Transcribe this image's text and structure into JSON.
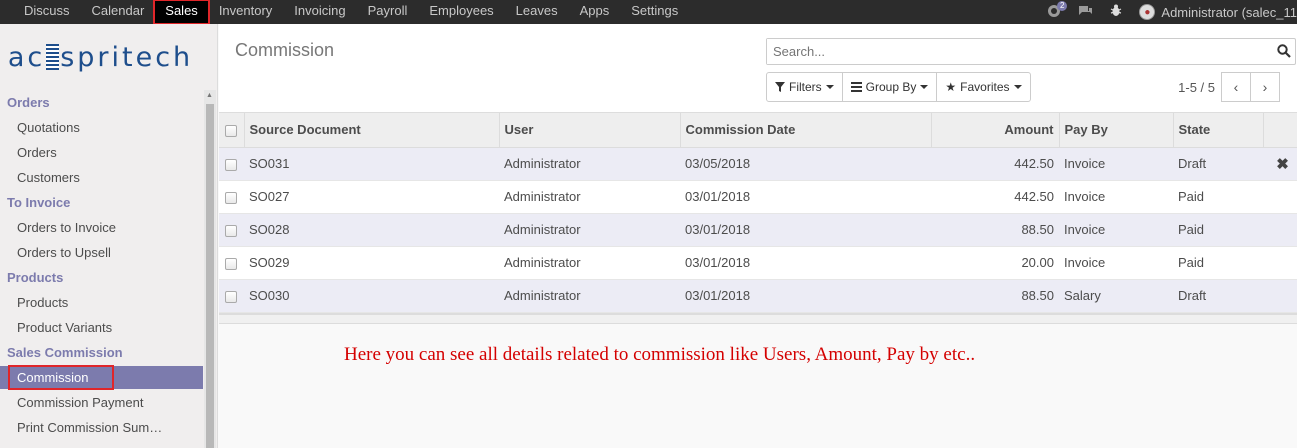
{
  "topbar": {
    "menu": [
      "Discuss",
      "Calendar",
      "Sales",
      "Inventory",
      "Invoicing",
      "Payroll",
      "Employees",
      "Leaves",
      "Apps",
      "Settings"
    ],
    "active_menu": "Sales",
    "chat_badge": "2",
    "user": "Administrator (salec_11"
  },
  "sidebar": {
    "logo": {
      "left": "ac",
      "right": "spritech"
    },
    "sections": [
      {
        "title": "Orders",
        "items": [
          "Quotations",
          "Orders",
          "Customers"
        ]
      },
      {
        "title": "To Invoice",
        "items": [
          "Orders to Invoice",
          "Orders to Upsell"
        ]
      },
      {
        "title": "Products",
        "items": [
          "Products",
          "Product Variants"
        ]
      },
      {
        "title": "Sales Commission",
        "items": [
          "Commission",
          "Commission Payment",
          "Print Commission Sum…"
        ]
      }
    ],
    "active_item": "Commission"
  },
  "control_panel": {
    "title": "Commission",
    "search_placeholder": "Search...",
    "filters_label": "Filters",
    "groupby_label": "Group By",
    "favorites_label": "Favorites",
    "pager": "1-5 / 5"
  },
  "table": {
    "columns": [
      "Source Document",
      "User",
      "Commission Date",
      "Amount",
      "Pay By",
      "State"
    ],
    "rows": [
      {
        "source": "SO031",
        "user": "Administrator",
        "date": "03/05/2018",
        "amount": "442.50",
        "pay_by": "Invoice",
        "state": "Draft"
      },
      {
        "source": "SO027",
        "user": "Administrator",
        "date": "03/01/2018",
        "amount": "442.50",
        "pay_by": "Invoice",
        "state": "Paid"
      },
      {
        "source": "SO028",
        "user": "Administrator",
        "date": "03/01/2018",
        "amount": "88.50",
        "pay_by": "Invoice",
        "state": "Paid"
      },
      {
        "source": "SO029",
        "user": "Administrator",
        "date": "03/01/2018",
        "amount": "20.00",
        "pay_by": "Invoice",
        "state": "Paid"
      },
      {
        "source": "SO030",
        "user": "Administrator",
        "date": "03/01/2018",
        "amount": "88.50",
        "pay_by": "Salary",
        "state": "Draft"
      }
    ]
  },
  "note": "Here you can see all details related to commission like Users, Amount, Pay by etc..",
  "colors": {
    "accent": "#7c7bad",
    "highlight_box": "#e0262a",
    "note_text": "#d40000",
    "topbar": "#2c2c2c"
  }
}
